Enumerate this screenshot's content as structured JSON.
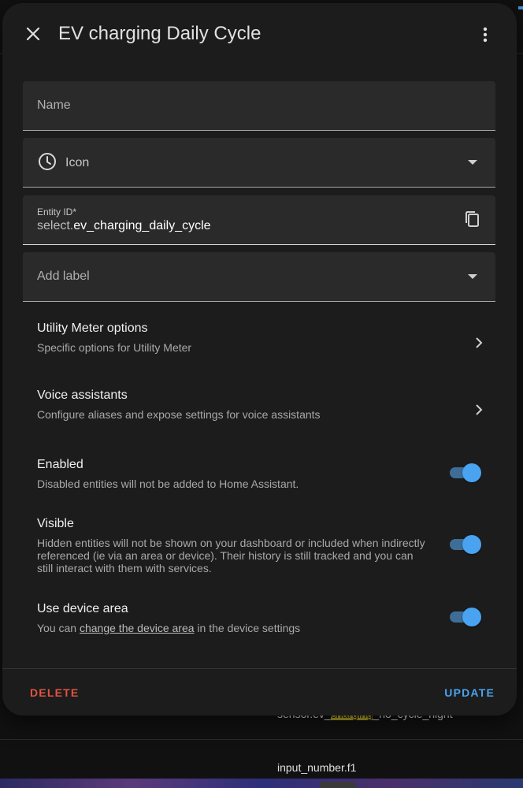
{
  "background": {
    "row1_pre": "sensor.ev_",
    "row1_hl": "charging",
    "row1_post": "_no_cycle_night",
    "row2": "input_number.f1"
  },
  "header": {
    "title": "EV charging Daily Cycle"
  },
  "form": {
    "name_label": "Name",
    "icon_label": "Icon",
    "entity_id_label": "Entity ID*",
    "entity_id_prefix": "select.",
    "entity_id_value": "ev_charging_daily_cycle",
    "add_label": "Add label"
  },
  "rows": {
    "utility_title": "Utility Meter options",
    "utility_sub": "Specific options for Utility Meter",
    "voice_title": "Voice assistants",
    "voice_sub": "Configure aliases and expose settings for voice assistants"
  },
  "toggles": {
    "enabled_title": "Enabled",
    "enabled_sub": "Disabled entities will not be added to Home Assistant.",
    "enabled_on": true,
    "visible_title": "Visible",
    "visible_sub": "Hidden entities will not be shown on your dashboard or included when indirectly referenced (ie via an area or device). Their history is still tracked and you can still interact with them with services.",
    "visible_on": true,
    "area_title": "Use device area",
    "area_sub_pre": "You can ",
    "area_sub_link": "change the device area",
    "area_sub_post": " in the device settings",
    "area_on": true
  },
  "footer": {
    "delete_label": "DELETE",
    "update_label": "UPDATE"
  },
  "colors": {
    "accent": "#4aa3f0",
    "danger": "#e0553f",
    "surface": "#1c1c1c",
    "field": "#2a2a2a"
  },
  "icons": [
    "close-icon",
    "more-vert-icon",
    "clock-icon",
    "dropdown-arrow-icon",
    "copy-icon",
    "chevron-right-icon"
  ]
}
